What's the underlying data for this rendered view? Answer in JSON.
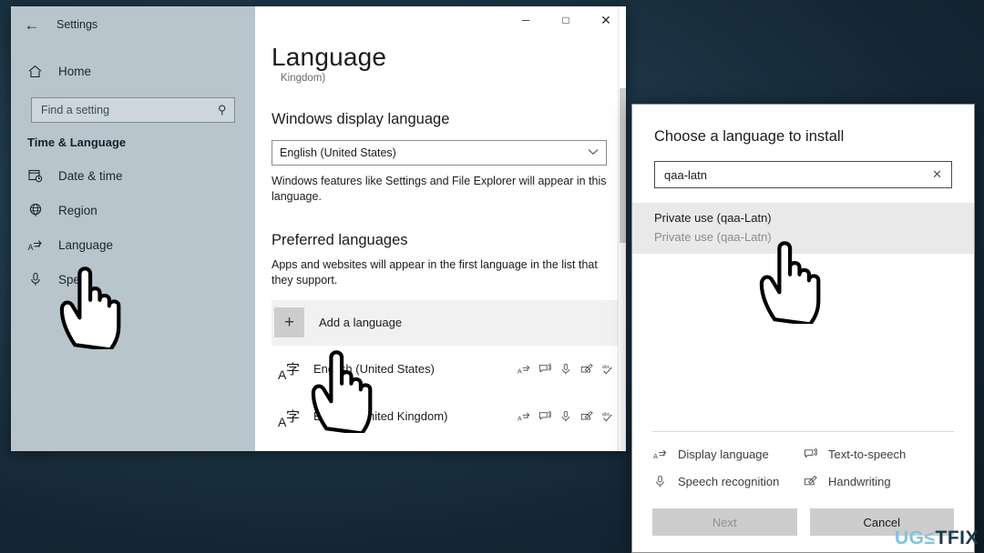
{
  "settings_window": {
    "titlebar": {
      "back_icon": "back-arrow-icon",
      "title": "Settings"
    },
    "window_controls": {
      "minimize": "─",
      "maximize": "□",
      "close": "✕"
    },
    "sidebar": {
      "home_label": "Home",
      "home_icon": "home-icon",
      "search": {
        "placeholder": "Find a setting",
        "value": "",
        "icon": "search-icon"
      },
      "group_label": "Time & Language",
      "items": [
        {
          "label": "Date & time",
          "icon": "calendar-clock-icon"
        },
        {
          "label": "Region",
          "icon": "globe-icon"
        },
        {
          "label": "Language",
          "icon": "display-language-icon"
        },
        {
          "label": "Spe",
          "icon": "microphone-icon"
        }
      ]
    },
    "main": {
      "page_title": "Language",
      "title_sub": "Kingdom)",
      "display_language": {
        "heading": "Windows display language",
        "selected": "English (United States)",
        "chevron": "⌄",
        "description": "Windows features like Settings and File Explorer will appear in this language."
      },
      "preferred_languages": {
        "heading": "Preferred languages",
        "description": "Apps and websites will appear in the first language in the list that they support.",
        "add_language_label": "Add a language",
        "add_language_icon": "plus-icon",
        "items": [
          {
            "name": "English (United States)",
            "icon": "language-abc-icon",
            "features": [
              "display-language-icon",
              "text-to-speech-icon",
              "microphone-icon",
              "handwriting-icon",
              "spellcheck-icon"
            ]
          },
          {
            "name": "English (United Kingdom)",
            "icon": "language-abc-icon",
            "features": [
              "display-language-icon",
              "text-to-speech-icon",
              "microphone-icon",
              "handwriting-icon",
              "spellcheck-icon"
            ]
          }
        ]
      }
    }
  },
  "install_dialog": {
    "title": "Choose a language to install",
    "search": {
      "value": "qaa-latn",
      "placeholder": "",
      "clear_icon": "close-icon"
    },
    "results": [
      {
        "primary": "Private use (qaa-Latn)",
        "secondary": "Private use (qaa-Latn)"
      }
    ],
    "legend": [
      {
        "label": "Display language",
        "icon": "display-language-icon"
      },
      {
        "label": "Text-to-speech",
        "icon": "text-to-speech-icon"
      },
      {
        "label": "Speech recognition",
        "icon": "microphone-icon"
      },
      {
        "label": "Handwriting",
        "icon": "handwriting-icon"
      }
    ],
    "buttons": {
      "next": "Next",
      "cancel": "Cancel"
    }
  },
  "cursors": [
    {
      "name": "cursor-over-language-sidebar-item"
    },
    {
      "name": "cursor-over-add-a-language"
    },
    {
      "name": "cursor-over-search-result"
    }
  ],
  "watermark": {
    "part_a": "UG",
    "part_b": "TFIX",
    "middle_glyph": "≤"
  },
  "colors": {
    "desktop_background": "#1d3646",
    "sidebar_background": "#b9c5cd",
    "window_background": "#ffffff",
    "hover_row": "#f1f1f1",
    "result_highlight": "#e9e9e9",
    "button_background": "#cdcdcd",
    "watermark_light": "#7fc5dd",
    "watermark_dark": "#1b3a4b"
  }
}
